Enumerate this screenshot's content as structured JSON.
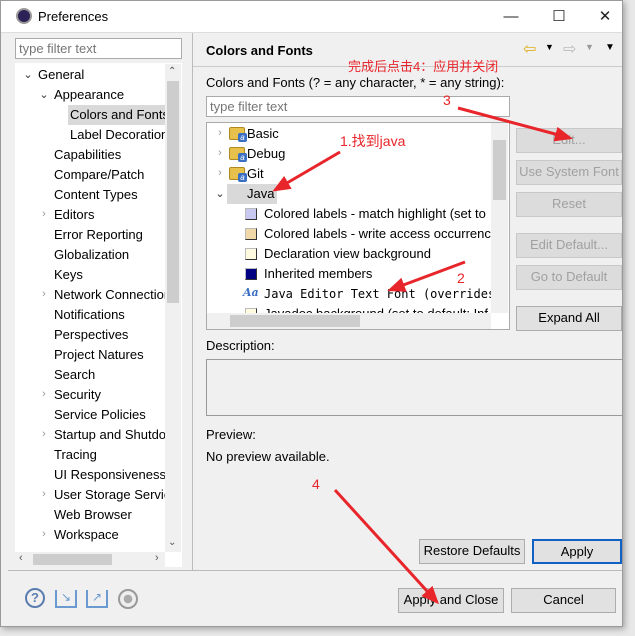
{
  "window": {
    "title": "Preferences",
    "minimize": "—",
    "maximize": "☐",
    "close": "✕"
  },
  "left": {
    "filter_placeholder": "type filter text",
    "tree": [
      {
        "label": "General",
        "level": 0,
        "expander": "open"
      },
      {
        "label": "Appearance",
        "level": 1,
        "expander": "open"
      },
      {
        "label": "Colors and Fonts",
        "level": 2,
        "expander": "none",
        "selected": true
      },
      {
        "label": "Label Decorations",
        "level": 2,
        "expander": "none"
      },
      {
        "label": "Capabilities",
        "level": 1,
        "expander": "none"
      },
      {
        "label": "Compare/Patch",
        "level": 1,
        "expander": "none"
      },
      {
        "label": "Content Types",
        "level": 1,
        "expander": "none"
      },
      {
        "label": "Editors",
        "level": 1,
        "expander": "closed"
      },
      {
        "label": "Error Reporting",
        "level": 1,
        "expander": "none"
      },
      {
        "label": "Globalization",
        "level": 1,
        "expander": "none"
      },
      {
        "label": "Keys",
        "level": 1,
        "expander": "none"
      },
      {
        "label": "Network Connections",
        "level": 1,
        "expander": "closed"
      },
      {
        "label": "Notifications",
        "level": 1,
        "expander": "none"
      },
      {
        "label": "Perspectives",
        "level": 1,
        "expander": "none"
      },
      {
        "label": "Project Natures",
        "level": 1,
        "expander": "none"
      },
      {
        "label": "Search",
        "level": 1,
        "expander": "none"
      },
      {
        "label": "Security",
        "level": 1,
        "expander": "closed"
      },
      {
        "label": "Service Policies",
        "level": 1,
        "expander": "none"
      },
      {
        "label": "Startup and Shutdown",
        "level": 1,
        "expander": "closed"
      },
      {
        "label": "Tracing",
        "level": 1,
        "expander": "none"
      },
      {
        "label": "UI Responsiveness",
        "level": 1,
        "expander": "none"
      },
      {
        "label": "User Storage Service",
        "level": 1,
        "expander": "closed"
      },
      {
        "label": "Web Browser",
        "level": 1,
        "expander": "none"
      },
      {
        "label": "Workspace",
        "level": 1,
        "expander": "closed"
      }
    ]
  },
  "right": {
    "title": "Colors and Fonts",
    "filter_label": "Colors and Fonts (? = any character, * = any string):",
    "filter_placeholder": "type filter text",
    "tree": [
      {
        "label": "Basic",
        "kind": "folder",
        "expander": "closed"
      },
      {
        "label": "Debug",
        "kind": "folder",
        "expander": "closed"
      },
      {
        "label": "Git",
        "kind": "folder",
        "expander": "closed"
      },
      {
        "label": "Java",
        "kind": "folder",
        "expander": "open",
        "selected": true
      },
      {
        "label": "Colored labels - match highlight (set to",
        "kind": "color",
        "color": "#c8c8f0"
      },
      {
        "label": "Colored labels - write access occurrence",
        "kind": "color",
        "color": "#f0d8a8"
      },
      {
        "label": "Declaration view background",
        "kind": "color",
        "color": "#fffbe0"
      },
      {
        "label": "Inherited members",
        "kind": "color",
        "color": "#000080"
      },
      {
        "label": "Java Editor Text Font (overrides",
        "kind": "font"
      },
      {
        "label": "Javadoc background (set to default: Inf",
        "kind": "color",
        "color": "#fffbe0"
      }
    ],
    "buttons": {
      "edit": "Edit...",
      "use_system_font": "Use System Font",
      "reset": "Reset",
      "edit_default": "Edit Default...",
      "go_to_default": "Go to Default",
      "expand_all": "Expand All"
    },
    "description_label": "Description:",
    "preview_label": "Preview:",
    "preview_text": "No preview available.",
    "restore_defaults": "Restore Defaults",
    "apply": "Apply"
  },
  "footer": {
    "apply_and_close": "Apply and Close",
    "cancel": "Cancel",
    "icons": [
      "help-icon",
      "import-icon",
      "export-icon",
      "oomph-icon"
    ]
  },
  "annotations": {
    "top": "完成后点击4：应用并关闭",
    "step1": "1.找到java",
    "step2": "2",
    "step3": "3",
    "step4": "4",
    "color": "#e8252a"
  }
}
